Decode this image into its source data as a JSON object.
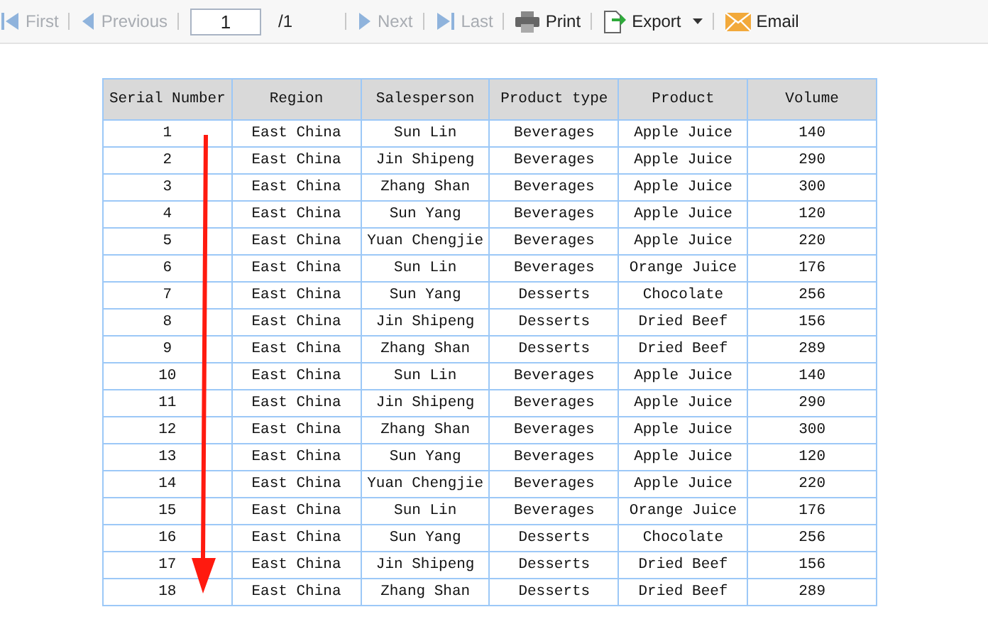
{
  "toolbar": {
    "items": [
      {
        "kind": "nav",
        "label": "First",
        "disabled": true
      },
      {
        "kind": "nav",
        "label": "Previous",
        "disabled": true
      },
      {
        "kind": "page",
        "value": "1",
        "total": "/1"
      },
      {
        "kind": "nav",
        "label": "Next",
        "disabled": true
      },
      {
        "kind": "nav",
        "label": "Last",
        "disabled": true
      },
      {
        "kind": "action",
        "label": "Print",
        "disabled": false
      },
      {
        "kind": "menu",
        "label": "Export",
        "disabled": false
      },
      {
        "kind": "action",
        "label": "Email",
        "disabled": false
      }
    ]
  },
  "table": {
    "columns": [
      "Serial Number",
      "Region",
      "Salesperson",
      "Product type",
      "Product",
      "Volume"
    ],
    "rows": [
      [
        "1",
        "East China",
        "Sun Lin",
        "Beverages",
        "Apple Juice",
        "140"
      ],
      [
        "2",
        "East China",
        "Jin Shipeng",
        "Beverages",
        "Apple Juice",
        "290"
      ],
      [
        "3",
        "East China",
        "Zhang Shan",
        "Beverages",
        "Apple Juice",
        "300"
      ],
      [
        "4",
        "East China",
        "Sun Yang",
        "Beverages",
        "Apple Juice",
        "120"
      ],
      [
        "5",
        "East China",
        "Yuan Chengjie",
        "Beverages",
        "Apple Juice",
        "220"
      ],
      [
        "6",
        "East China",
        "Sun Lin",
        "Beverages",
        "Orange Juice",
        "176"
      ],
      [
        "7",
        "East China",
        "Sun Yang",
        "Desserts",
        "Chocolate",
        "256"
      ],
      [
        "8",
        "East China",
        "Jin Shipeng",
        "Desserts",
        "Dried Beef",
        "156"
      ],
      [
        "9",
        "East China",
        "Zhang Shan",
        "Desserts",
        "Dried Beef",
        "289"
      ],
      [
        "10",
        "East China",
        "Sun Lin",
        "Beverages",
        "Apple Juice",
        "140"
      ],
      [
        "11",
        "East China",
        "Jin Shipeng",
        "Beverages",
        "Apple Juice",
        "290"
      ],
      [
        "12",
        "East China",
        "Zhang Shan",
        "Beverages",
        "Apple Juice",
        "300"
      ],
      [
        "13",
        "East China",
        "Sun Yang",
        "Beverages",
        "Apple Juice",
        "120"
      ],
      [
        "14",
        "East China",
        "Yuan Chengjie",
        "Beverages",
        "Apple Juice",
        "220"
      ],
      [
        "15",
        "East China",
        "Sun Lin",
        "Beverages",
        "Orange Juice",
        "176"
      ],
      [
        "16",
        "East China",
        "Sun Yang",
        "Desserts",
        "Chocolate",
        "256"
      ],
      [
        "17",
        "East China",
        "Jin Shipeng",
        "Desserts",
        "Dried Beef",
        "156"
      ],
      [
        "18",
        "East China",
        "Zhang Shan",
        "Desserts",
        "Dried Beef",
        "289"
      ]
    ]
  }
}
